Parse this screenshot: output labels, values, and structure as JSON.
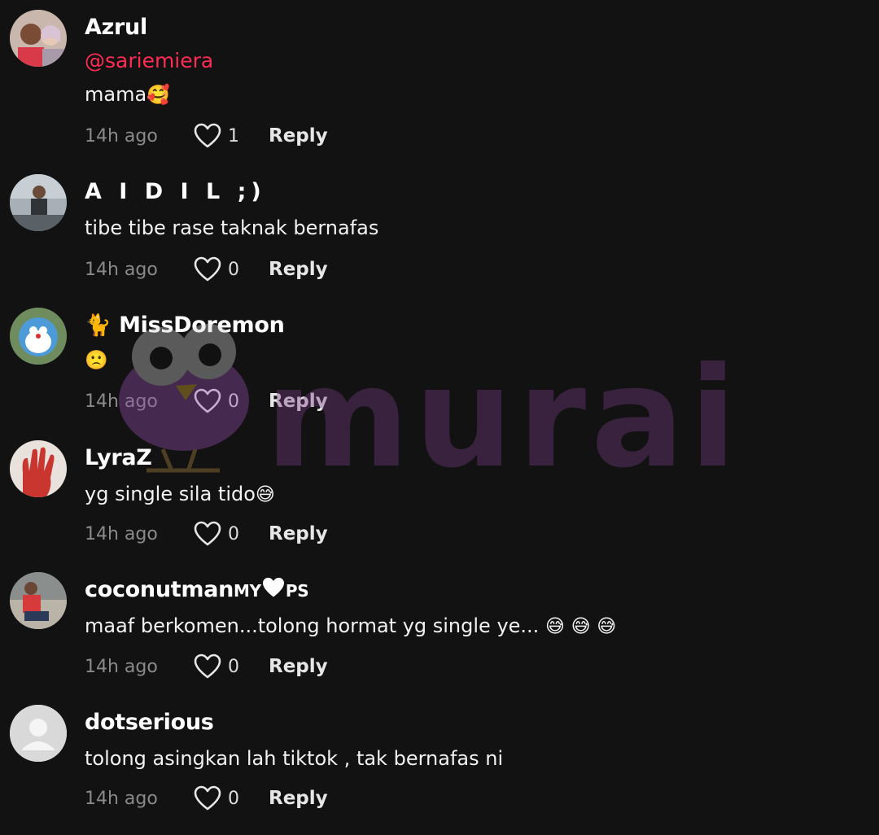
{
  "comments": [
    {
      "username": "Azrul",
      "mention": "@sariemiera",
      "text": "mama",
      "emojis": [
        "🥰"
      ],
      "time": "14h ago",
      "likes": "1",
      "reply": "Reply"
    },
    {
      "username": "A I D I L ;)",
      "text": "tibe tibe rase taknak bernafas",
      "time": "14h ago",
      "likes": "0",
      "reply": "Reply"
    },
    {
      "username_badge": "🐈",
      "username": "MissDoremon",
      "text_emoji": "🙁",
      "time": "14h ago",
      "likes": "0",
      "reply": "Reply"
    },
    {
      "username": "LyraZ",
      "text": "yg single sila tido",
      "emojis": [
        "😅"
      ],
      "time": "14h ago",
      "likes": "0",
      "reply": "Reply"
    },
    {
      "username": "coconutman",
      "username_suffix_a": "MY",
      "username_suffix_b": "PS",
      "text": "maaf berkomen...tolong hormat yg single ye...",
      "emojis": [
        "😅",
        "😅",
        "😅"
      ],
      "time": "14h ago",
      "likes": "0",
      "reply": "Reply"
    },
    {
      "username": "dotserious",
      "text": "tolong asingkan lah tiktok , tak bernafas ni",
      "time": "14h ago",
      "likes": "0",
      "reply": "Reply"
    }
  ],
  "watermark": {
    "text": "murai",
    "color": "#7a3d86"
  }
}
